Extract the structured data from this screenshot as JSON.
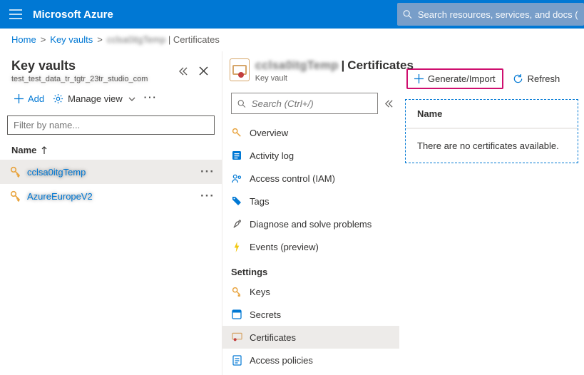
{
  "topbar": {
    "brand": "Microsoft Azure",
    "search_placeholder": "Search resources, services, and docs (G+/"
  },
  "breadcrumb": {
    "home": "Home",
    "keyvaults": "Key vaults",
    "current_resource_masked": "cclsa0itgTemp",
    "tail": "Certificates"
  },
  "left": {
    "title": "Key vaults",
    "subtitle_masked": "test_test_data_tr_tgtr_23tr_studio_com",
    "add_label": "Add",
    "manage_view_label": "Manage view",
    "filter_placeholder": "Filter by name...",
    "name_col": "Name",
    "items": [
      {
        "label_masked": "cclsa0itgTemp",
        "selected": true
      },
      {
        "label_masked": "AzureEuropeV2",
        "selected": false
      }
    ]
  },
  "mid": {
    "resource_name_masked": "cclsa0itgTemp",
    "resource_tail": "Certificates",
    "resource_type": "Key vault",
    "search_placeholder": "Search (Ctrl+/)",
    "nav": [
      {
        "label": "Overview",
        "icon": "overview",
        "active": false
      },
      {
        "label": "Activity log",
        "icon": "activity",
        "active": false
      },
      {
        "label": "Access control (IAM)",
        "icon": "iam",
        "active": false
      },
      {
        "label": "Tags",
        "icon": "tags",
        "active": false
      },
      {
        "label": "Diagnose and solve problems",
        "icon": "diagnose",
        "active": false
      },
      {
        "label": "Events (preview)",
        "icon": "events",
        "active": false
      }
    ],
    "settings_label": "Settings",
    "settings_nav": [
      {
        "label": "Keys",
        "icon": "keys",
        "active": false
      },
      {
        "label": "Secrets",
        "icon": "secrets",
        "active": false
      },
      {
        "label": "Certificates",
        "icon": "certs",
        "active": true
      },
      {
        "label": "Access policies",
        "icon": "policies",
        "active": false
      }
    ]
  },
  "right": {
    "generate_import_label": "Generate/Import",
    "refresh_label": "Refresh",
    "name_col": "Name",
    "empty_msg": "There are no certificates available."
  },
  "colors": {
    "azure_blue": "#0078d4",
    "highlight_pink": "#cf0f6f"
  }
}
